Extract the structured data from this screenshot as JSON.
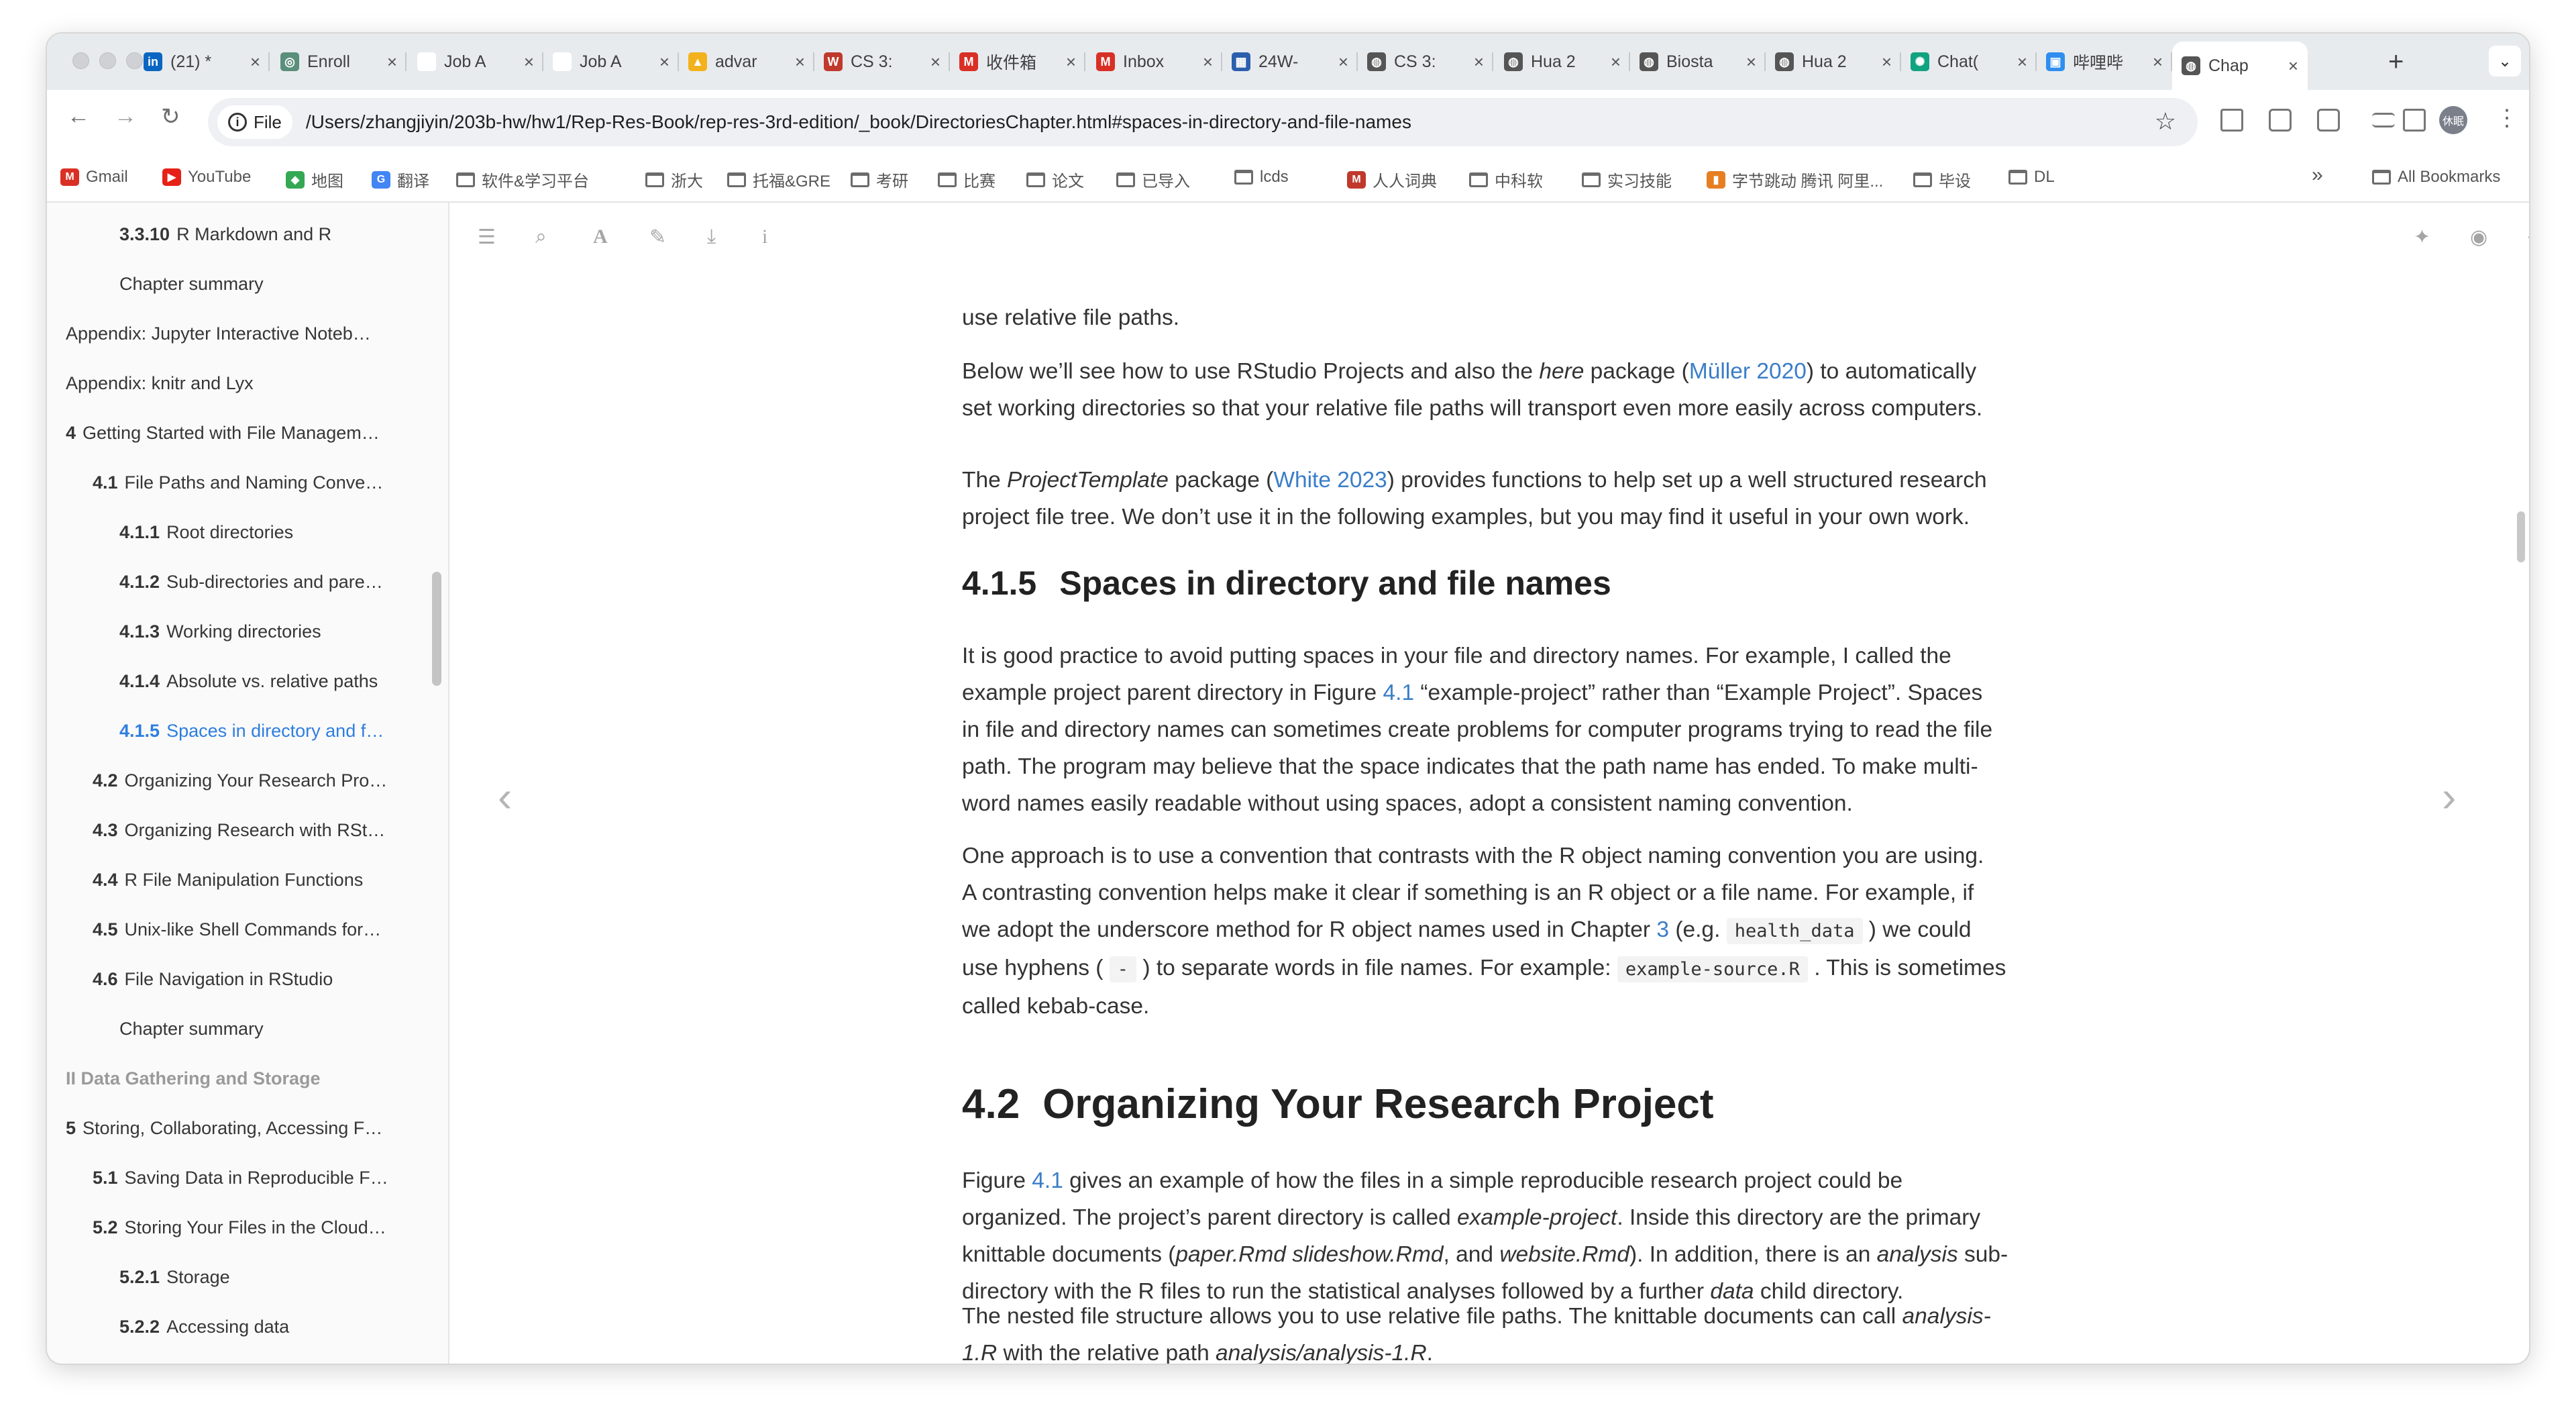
{
  "browser": {
    "tabs": [
      {
        "title": "(21) *",
        "icon": "linkedin-icon",
        "color": "#0a66c2",
        "glyph": "in"
      },
      {
        "title": "Enroll",
        "icon": "globe-icon",
        "color": "#5a8f7b",
        "glyph": "◎"
      },
      {
        "title": "Job A",
        "icon": "blank-icon",
        "color": "#ffffff",
        "glyph": ""
      },
      {
        "title": "Job A",
        "icon": "blank-icon",
        "color": "#ffffff",
        "glyph": ""
      },
      {
        "title": "advar",
        "icon": "drive-icon",
        "color": "#f3b21d",
        "glyph": "▲"
      },
      {
        "title": "CS 3:",
        "icon": "canvas-icon",
        "color": "#c0392b",
        "glyph": "W"
      },
      {
        "title": "收件箱",
        "icon": "gmail-icon",
        "color": "#d93025",
        "glyph": "M"
      },
      {
        "title": "Inbox",
        "icon": "gmail-icon",
        "color": "#d93025",
        "glyph": "M"
      },
      {
        "title": "24W-",
        "icon": "doc-icon",
        "color": "#2b5fad",
        "glyph": "▦"
      },
      {
        "title": "CS 3:",
        "icon": "globe-icon",
        "color": "#555555",
        "glyph": "◍"
      },
      {
        "title": "Hua 2",
        "icon": "globe-icon",
        "color": "#555555",
        "glyph": "◍"
      },
      {
        "title": "Biosta",
        "icon": "globe-icon",
        "color": "#555555",
        "glyph": "◍"
      },
      {
        "title": "Hua 2",
        "icon": "globe-icon",
        "color": "#555555",
        "glyph": "◍"
      },
      {
        "title": "Chat(",
        "icon": "chatgpt-icon",
        "color": "#10a37f",
        "glyph": "✺"
      },
      {
        "title": "哔哩哔",
        "icon": "bilibili-icon",
        "color": "#2f8ef0",
        "glyph": "▣"
      },
      {
        "title": "Chap",
        "icon": "globe-icon",
        "color": "#555555",
        "glyph": "◍"
      }
    ],
    "address": {
      "scheme_chip": "File",
      "url": "/Users/zhangjiyin/203b-hw/hw1/Rep-Res-Book/rep-res-3rd-edition/_book/DirectoriesChapter.html#spaces-in-directory-and-file-names"
    },
    "avatar_text": "休眠",
    "bookmarks": [
      {
        "label": "Gmail",
        "type": "favicon",
        "color": "#d93025",
        "glyph": "M"
      },
      {
        "label": "YouTube",
        "type": "favicon",
        "color": "#e62117",
        "glyph": "▶"
      },
      {
        "label": "地图",
        "type": "favicon",
        "color": "#34a853",
        "glyph": "◆"
      },
      {
        "label": "翻译",
        "type": "favicon",
        "color": "#4285f4",
        "glyph": "G"
      },
      {
        "label": "软件&学习平台",
        "type": "folder"
      },
      {
        "label": "浙大",
        "type": "folder"
      },
      {
        "label": "托福&GRE",
        "type": "folder"
      },
      {
        "label": "考研",
        "type": "folder"
      },
      {
        "label": "比赛",
        "type": "folder"
      },
      {
        "label": "论文",
        "type": "folder"
      },
      {
        "label": "已导入",
        "type": "folder"
      },
      {
        "label": "lcds",
        "type": "folder"
      },
      {
        "label": "人人词典",
        "type": "favicon",
        "color": "#c0392b",
        "glyph": "M"
      },
      {
        "label": "中科软",
        "type": "folder"
      },
      {
        "label": "实习技能",
        "type": "folder"
      },
      {
        "label": "字节跳动 腾讯 阿里...",
        "type": "favicon",
        "color": "#e67e22",
        "glyph": "▮"
      },
      {
        "label": "毕设",
        "type": "folder"
      },
      {
        "label": "DL",
        "type": "folder"
      }
    ],
    "overflow_label": "»",
    "all_bookmarks": "All Bookmarks"
  },
  "toc": [
    {
      "num": "3.3.10",
      "label": "R Markdown and R",
      "level": 3
    },
    {
      "num": "",
      "label": "Chapter summary",
      "level": 3
    },
    {
      "num": "",
      "label": "Appendix: Jupyter Interactive Noteb…",
      "level": 1
    },
    {
      "num": "",
      "label": "Appendix: knitr and Lyx",
      "level": 1
    },
    {
      "num": "4",
      "label": "Getting Started with File Managem…",
      "level": 1
    },
    {
      "num": "4.1",
      "label": "File Paths and Naming Conve…",
      "level": 2
    },
    {
      "num": "4.1.1",
      "label": "Root directories",
      "level": 3
    },
    {
      "num": "4.1.2",
      "label": "Sub-directories and pare…",
      "level": 3
    },
    {
      "num": "4.1.3",
      "label": "Working directories",
      "level": 3
    },
    {
      "num": "4.1.4",
      "label": "Absolute vs. relative paths",
      "level": 3
    },
    {
      "num": "4.1.5",
      "label": "Spaces in directory and f…",
      "level": 3,
      "active": true
    },
    {
      "num": "4.2",
      "label": "Organizing Your Research Pro…",
      "level": 2
    },
    {
      "num": "4.3",
      "label": "Organizing Research with RSt…",
      "level": 2
    },
    {
      "num": "4.4",
      "label": "R File Manipulation Functions",
      "level": 2
    },
    {
      "num": "4.5",
      "label": "Unix-like Shell Commands for…",
      "level": 2
    },
    {
      "num": "4.6",
      "label": "File Navigation in RStudio",
      "level": 2
    },
    {
      "num": "",
      "label": "Chapter summary",
      "level": 3
    },
    {
      "num": "",
      "label": "II Data Gathering and Storage",
      "level": 1,
      "part": true
    },
    {
      "num": "5",
      "label": "Storing, Collaborating, Accessing F…",
      "level": 1
    },
    {
      "num": "5.1",
      "label": "Saving Data in Reproducible F…",
      "level": 2
    },
    {
      "num": "5.2",
      "label": "Storing Your Files in the Cloud…",
      "level": 2
    },
    {
      "num": "5.2.1",
      "label": "Storage",
      "level": 3
    },
    {
      "num": "5.2.2",
      "label": "Accessing data",
      "level": 3
    },
    {
      "num": "5.2.3",
      "label": "Collaboration",
      "level": 3
    }
  ],
  "content": {
    "p0": "use relative file paths.",
    "p1": {
      "a": "Below we’ll see how to use RStudio Projects and also the ",
      "b": "here",
      "c": " package (",
      "cite": "Müller 2020",
      "d": ") to automatically",
      "e": "set working directories so that your relative file paths will transport even more easily across computers."
    },
    "p2": {
      "a": "The ",
      "b": "ProjectTemplate",
      "c": " package (",
      "cite": "White 2023",
      "d": ") provides functions to help set up a well structured research",
      "e": "project file tree. We don’t use it in the following examples, but you may find it useful in your own work."
    },
    "h415": {
      "num": "4.1.5",
      "title": "Spaces in directory and file names"
    },
    "p3": {
      "l1": "It is good practice to avoid putting spaces in your file and directory names. For example, I called the",
      "l2a": "example project parent directory in Figure ",
      "fig": "4.1",
      "l2b": " “example-project” rather than “Example Project”. Spaces",
      "l3": "in file and directory names can sometimes create problems for computer programs trying to read the file",
      "l4": "path. The program may believe that the space indicates that the path name has ended. To make multi-",
      "l5": "word names easily readable without using spaces, adopt a consistent naming convention."
    },
    "p4": {
      "l1": "One approach is to use a convention that contrasts with the R object naming convention you are using.",
      "l2": "A contrasting convention helps make it clear if something is an R object or a file name. For example, if",
      "l3a": "we adopt the underscore method for R object names used in Chapter ",
      "ch": "3",
      "l3b": " (e.g. ",
      "code1": "health_data",
      "l3c": " ) we could",
      "l4a": "use hyphens ( ",
      "code2": "-",
      "l4b": " ) to separate words in file names. For example: ",
      "code3": "example-source.R",
      "l4c": " . This is sometimes",
      "l5": "called kebab-case."
    },
    "h42": {
      "num": "4.2",
      "title": "Organizing Your Research Project"
    },
    "p5": {
      "l1a": "Figure ",
      "fig": "4.1",
      "l1b": " gives an example of how the files in a simple reproducible research project could be",
      "l2a": "organized. The project’s parent directory is called ",
      "l2i": "example-project",
      "l2b": ". Inside this directory are the primary",
      "l3a": "knittable documents (",
      "l3i": "paper.Rmd slideshow.Rmd",
      "l3b": ", and ",
      "l3i2": "website.Rmd",
      "l3c": "). In addition, there is an ",
      "l3i3": "analysis",
      "l3d": " sub-",
      "l4a": "directory with the R files to run the statistical analyses followed by a further ",
      "l4i": "data",
      "l4b": " child directory."
    },
    "p6": {
      "l1a": "The nested file structure allows you to use relative file paths. The knittable documents can call ",
      "l1i": "analysis-",
      "l2i": "1.R",
      "l2a": " with the relative path ",
      "l2i2": "analysis/analysis-1.R",
      "l2b": "."
    }
  }
}
